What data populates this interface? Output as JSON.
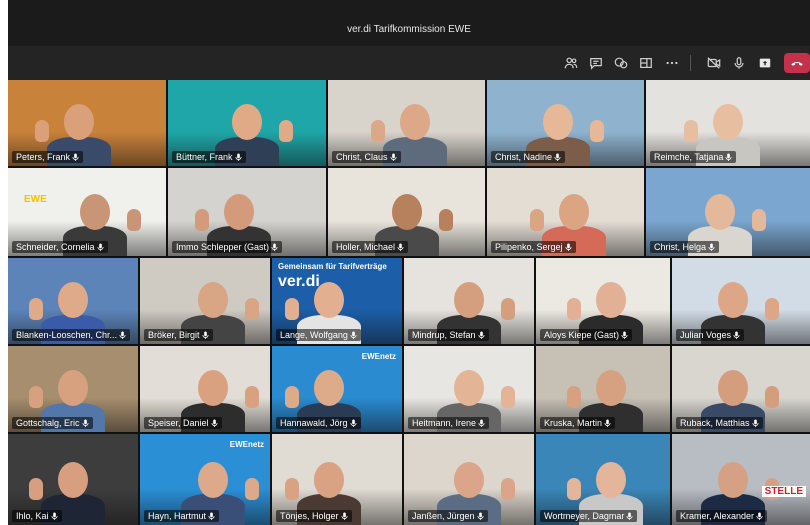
{
  "window": {
    "title": "ver.di Tarifkommission EWE"
  },
  "toolbar": {
    "icons": [
      "people-icon",
      "chat-icon",
      "reactions-icon",
      "rooms-icon",
      "more-icon",
      "camera-icon",
      "mic-icon",
      "share-icon",
      "hangup-icon"
    ],
    "hangup_color": "#c4314b"
  },
  "participants": [
    {
      "name": "Peters, Frank",
      "bg": "#c9823a",
      "skin": "#d9a07a",
      "shirt": "#3a4a6a"
    },
    {
      "name": "Büttner, Frank",
      "bg": "#1fa6a8",
      "skin": "#e0aa86",
      "shirt": "#2f3f55"
    },
    {
      "name": "Christ, Claus",
      "bg": "#d8d4cc",
      "skin": "#dca887",
      "shirt": "#5d6b7c"
    },
    {
      "name": "Christ, Nadine",
      "bg": "#8fb3cf",
      "skin": "#e6b897",
      "shirt": "#7b5d4a"
    },
    {
      "name": "Reimche, Tatjana",
      "bg": "#e4e2de",
      "skin": "#e8bea0",
      "shirt": "#c8c6c1"
    },
    {
      "name": "Schneider, Cornelia",
      "bg": "#f0f0ec",
      "skin": "#c89577",
      "shirt": "#3a3a3a",
      "logo": "EWE"
    },
    {
      "name": "Immo Schlepper (Gast)",
      "bg": "#d5d3cf",
      "skin": "#d39b7b",
      "shirt": "#333333"
    },
    {
      "name": "Holler, Michael",
      "bg": "#e8e4dc",
      "skin": "#b6815c",
      "shirt": "#4a4a4a"
    },
    {
      "name": "Pilipenko, Sergej",
      "bg": "#e3ddd4",
      "skin": "#dba483",
      "shirt": "#d46a57"
    },
    {
      "name": "Christ, Helga",
      "bg": "#7aa6cf",
      "skin": "#e4b89a",
      "shirt": "#d9d6d0"
    },
    {
      "name": "Blanken-Looschen, Chr...",
      "bg": "#5c84b8",
      "skin": "#deaa8a",
      "shirt": "#3a5ca8"
    },
    {
      "name": "Bröker, Birgit",
      "bg": "#cfcac2",
      "skin": "#d8a585",
      "shirt": "#444444"
    },
    {
      "name": "Lange, Wolfgang",
      "bg": "#1c5fa8",
      "skin": "#e2b090",
      "shirt": "#e4e4e4",
      "banner": "Gemeinsam für Tarifverträge",
      "logo": "ver.di"
    },
    {
      "name": "Mindrup, Stefan",
      "bg": "#e6e3de",
      "skin": "#d49f7e",
      "shirt": "#333333"
    },
    {
      "name": "Aloys Kiepe (Gast)",
      "bg": "#ece8e2",
      "skin": "#e2b095",
      "shirt": "#2b2b2b"
    },
    {
      "name": "Julian Voges",
      "bg": "#d2dce6",
      "skin": "#dda787",
      "shirt": "#333333"
    },
    {
      "name": "Gottschalg, Eric",
      "bg": "#a68e6e",
      "skin": "#d7a17f",
      "shirt": "#5377a8"
    },
    {
      "name": "Speiser, Daniel",
      "bg": "#e2ddd6",
      "skin": "#d9a180",
      "shirt": "#2d2d2d"
    },
    {
      "name": "Hannawald, Jörg",
      "bg": "#2a8bd0",
      "skin": "#ddaa8a",
      "shirt": "#2a3c55",
      "logo": "EWEnetz"
    },
    {
      "name": "Heitmann, Irene",
      "bg": "#e8e6e2",
      "skin": "#e3b496",
      "shirt": "#666666"
    },
    {
      "name": "Kruska, Martin",
      "bg": "#c6c0b5",
      "skin": "#d6a181",
      "shirt": "#2f2f2f"
    },
    {
      "name": "Ruback, Matthias",
      "bg": "#d9d6d0",
      "skin": "#d49e7e",
      "shirt": "#384a66"
    },
    {
      "name": "Ihlo, Kai",
      "bg": "#3d3d3d",
      "skin": "#d79f80",
      "shirt": "#1e2636"
    },
    {
      "name": "Hayn, Hartmut",
      "bg": "#2b8fd6",
      "skin": "#dcaa8a",
      "shirt": "#3a4f78",
      "logo": "EWEnetz"
    },
    {
      "name": "Tönjes, Holger",
      "bg": "#e0dbd3",
      "skin": "#d8a283",
      "shirt": "#4a3a33"
    },
    {
      "name": "Janßen, Jürgen",
      "bg": "#dcd6cc",
      "skin": "#dba58a",
      "shirt": "#5b6d84"
    },
    {
      "name": "Wortmeyer, Dagmar",
      "bg": "#3a86b8",
      "skin": "#e3b59a",
      "shirt": "#c8c8c8"
    },
    {
      "name": "Kramer, Alexander",
      "bg": "#b8bcc3",
      "skin": "#d5a083",
      "shirt": "#1d2a44",
      "sign": "STELLE"
    }
  ]
}
